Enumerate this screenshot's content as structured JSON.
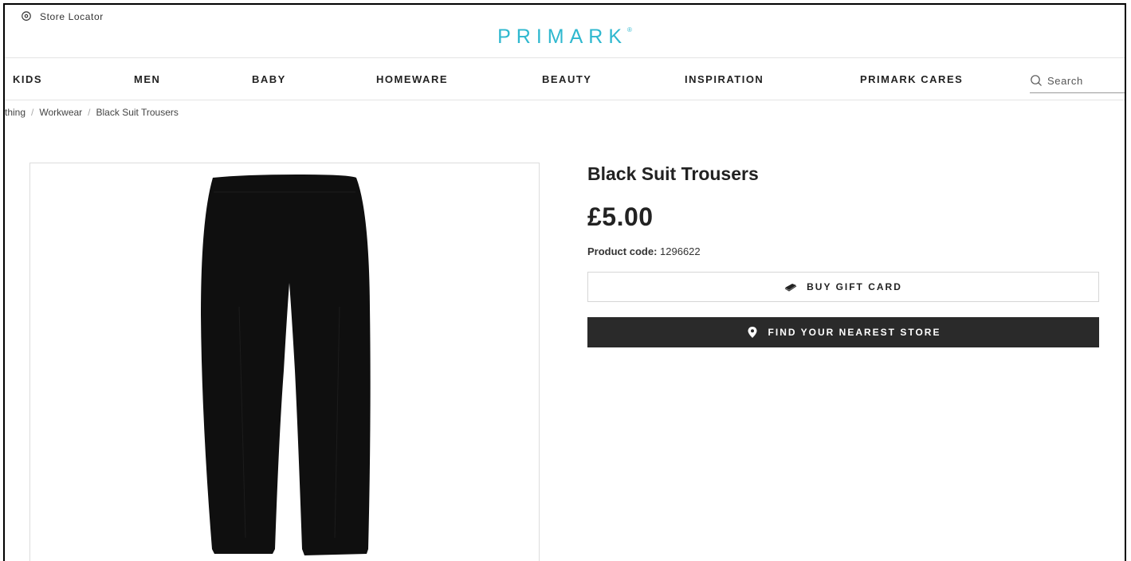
{
  "header": {
    "store_locator": "Store Locator",
    "logo": "PRIMARK",
    "logo_mark": "®"
  },
  "nav": {
    "items": [
      {
        "label": "KIDS"
      },
      {
        "label": "MEN"
      },
      {
        "label": "BABY"
      },
      {
        "label": "HOMEWARE"
      },
      {
        "label": "BEAUTY"
      },
      {
        "label": "INSPIRATION"
      },
      {
        "label": "PRIMARK CARES"
      }
    ],
    "search_placeholder": "Search"
  },
  "breadcrumb": {
    "items": [
      "thing",
      "Workwear",
      "Black Suit Trousers"
    ],
    "separator": "/"
  },
  "product": {
    "title": "Black Suit Trousers",
    "price": "£5.00",
    "code_label": "Product code:",
    "code": "1296622",
    "buy_gift_card": "BUY GIFT CARD",
    "find_store": "FIND YOUR NEAREST STORE"
  },
  "colors": {
    "brand": "#2fb8cf",
    "dark_button": "#2a2a2a",
    "product": "#111111"
  },
  "icons": {
    "store_locator": "map-pin-outline-icon",
    "search": "search-icon",
    "gift_card": "gift-card-icon",
    "find_store": "map-pin-icon"
  }
}
